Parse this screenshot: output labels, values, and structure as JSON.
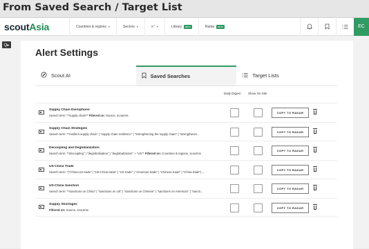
{
  "caption": "From Saved Search / Target List",
  "header": {
    "logo_scout": "scout",
    "logo_asia": "Asia",
    "nav": [
      {
        "label": "Countries & regions",
        "chevron": "▾",
        "badge": ""
      },
      {
        "label": "Sectors",
        "chevron": "▾",
        "badge": ""
      },
      {
        "label": "≡°",
        "chevron": "▾",
        "badge": ""
      },
      {
        "label": "Library",
        "chevron": "",
        "badge": "BETA"
      },
      {
        "label": "Radar",
        "chevron": "",
        "badge": "BETA"
      }
    ],
    "icons": [
      "bell-icon",
      "bookmark-icon",
      "list-icon"
    ],
    "avatar": "EC"
  },
  "side_button": "Q▸",
  "page": {
    "title": "Alert Settings",
    "tabs": [
      {
        "label": "Scout AI",
        "icon": "compass-icon",
        "active": false
      },
      {
        "label": "Saved Searches",
        "icon": "bookmark-icon",
        "active": true
      },
      {
        "label": "Target Lists",
        "icon": "list-icon",
        "active": false
      }
    ],
    "columns": {
      "daily_digest": "Daily Digest",
      "show_on_site": "Show On Site"
    },
    "copy_label": "COPY TO RADAR",
    "rows": [
      {
        "name": "Supply Chain Disruptions",
        "search_label": "Search term:",
        "search_value": " **supply chain**",
        "filter_label": " Filtered on:",
        "filter_value": " Source, scoutAIs"
      },
      {
        "name": "Supply Chain Strategies",
        "search_label": "Search term:",
        "search_value": " **resilient supply chain\" | \"supply chain resilience\" | \"strengthening the supply chain\" | \"strengthenin...",
        "filter_label": "",
        "filter_value": ""
      },
      {
        "name": "Decoupling and Deglobalization",
        "search_label": "Search term:",
        "search_value": " **decoupling\" | \"deglobalisation\" | \"deglobalization\" + \"US\"*",
        "filter_label": " Filtered on:",
        "filter_value": " Countries & regions, scoutAIs"
      },
      {
        "name": "US-China Trade",
        "search_label": "Search term:",
        "search_value": " *(\"China-US trade\" | \"US-China trade\" | \"US trade\" | \"American trade\" | \"Chinese trade\" | \"China trade\")...",
        "filter_label": "",
        "filter_value": ""
      },
      {
        "name": "US-China Sanction",
        "search_label": "Search term:",
        "search_value": " **sanctions on China\" | \"sanctions on US\" | \"sanctions on Chinese\" | \"sanctions on American\" | \"sancti...",
        "filter_label": "",
        "filter_value": ""
      },
      {
        "name": "Supply Shortages",
        "search_label": "",
        "search_value": "",
        "filter_label": "Filtered on:",
        "filter_value": " Source, scoutAIs"
      }
    ]
  },
  "colors": {
    "accent": "#2f9b63",
    "logo_dark": "#1c2a33"
  }
}
